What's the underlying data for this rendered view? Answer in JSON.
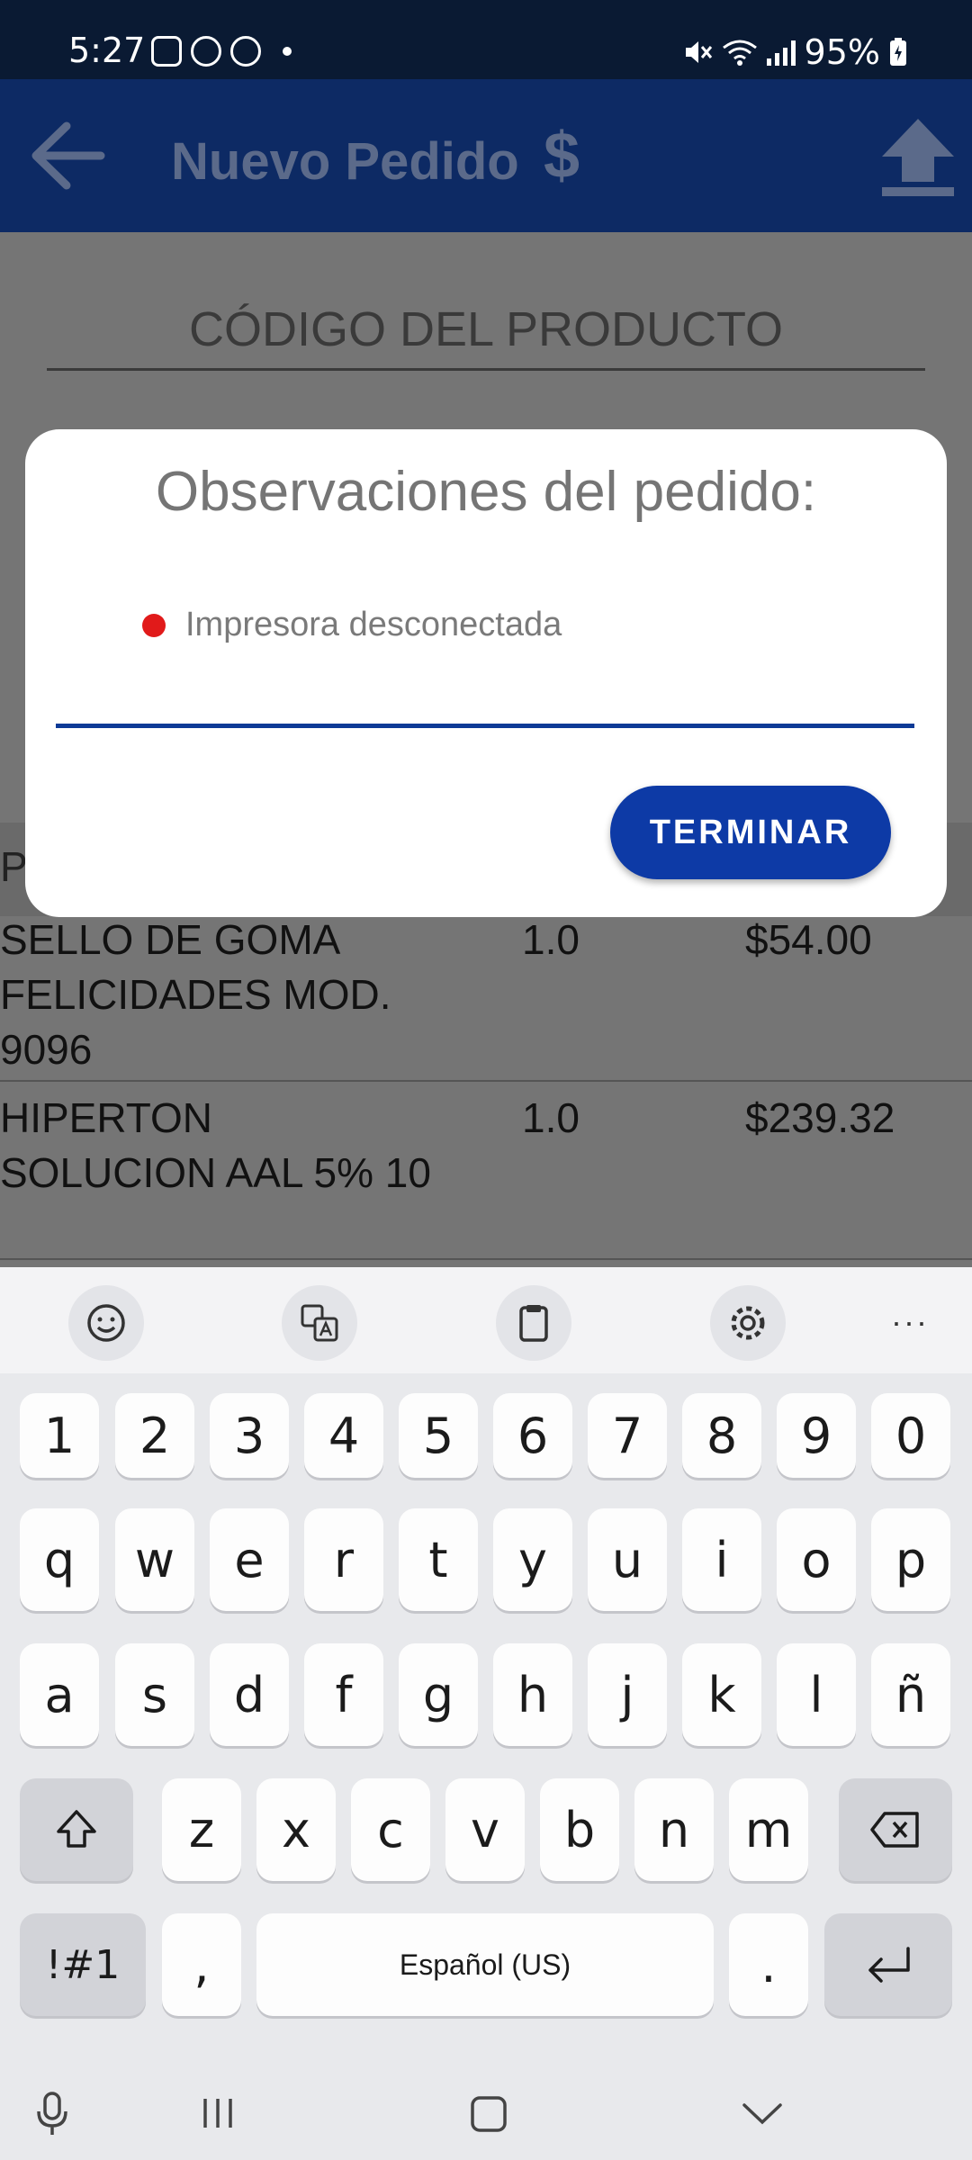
{
  "status_bar": {
    "time": "5:27",
    "battery": "95%"
  },
  "app_bar": {
    "title": "Nuevo Pedido",
    "currency_symbol": "$",
    "color": "#0d2a64"
  },
  "form": {
    "code_label": "CÓDIGO DEL PRODUCTO"
  },
  "table": {
    "header_partial": "P",
    "rows": [
      {
        "name": "SELLO DE GOMA FELICIDADES MOD. 9096",
        "qty": "1.0",
        "price": "$54.00"
      },
      {
        "name": "HIPERTON SOLUCION AAL 5% 10",
        "qty": "1.0",
        "price": "$239.32"
      }
    ]
  },
  "dialog": {
    "title": "Observaciones del pedido:",
    "printer_status": "Impresora desconectada",
    "printer_status_color": "#e11a1a",
    "input_value": "",
    "finish_label": "TERMINAR",
    "accent": "#0d3aa6"
  },
  "keyboard": {
    "toolbar": [
      "emoji-icon",
      "translate-icon",
      "clipboard-icon",
      "settings-icon",
      "more-icon"
    ],
    "more_label": "···",
    "row_numbers": [
      "1",
      "2",
      "3",
      "4",
      "5",
      "6",
      "7",
      "8",
      "9",
      "0"
    ],
    "row_1": [
      "q",
      "w",
      "e",
      "r",
      "t",
      "y",
      "u",
      "i",
      "o",
      "p"
    ],
    "row_2": [
      "a",
      "s",
      "d",
      "f",
      "g",
      "h",
      "j",
      "k",
      "l",
      "ñ"
    ],
    "row_3": [
      "z",
      "x",
      "c",
      "v",
      "b",
      "n",
      "m"
    ],
    "symbols_label": "!#1",
    "comma": ",",
    "space_label": "Español (US)",
    "period": "."
  }
}
